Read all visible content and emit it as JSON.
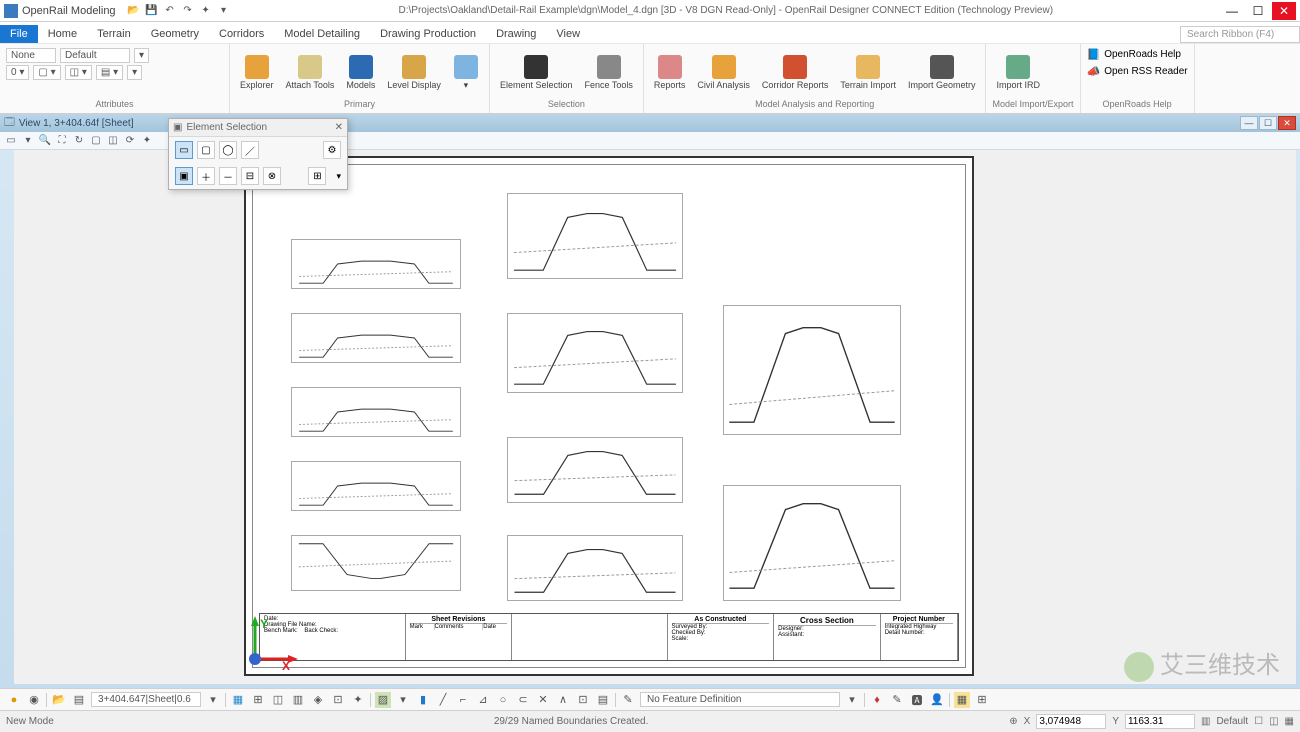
{
  "titlebar": {
    "app_name": "OpenRail Modeling",
    "document_title": "D:\\Projects\\Oakland\\Detail-Rail Example\\dgn\\Model_4.dgn [3D - V8 DGN Read-Only] - OpenRail Designer CONNECT Edition (Technology Preview)"
  },
  "ribbon": {
    "tabs": [
      "File",
      "Home",
      "Terrain",
      "Geometry",
      "Corridors",
      "Model Detailing",
      "Drawing Production",
      "Drawing",
      "View"
    ],
    "active_tab": "File",
    "search_placeholder": "Search Ribbon (F4)",
    "groups": {
      "attributes": {
        "label": "Attributes",
        "level": "None",
        "color": "Default"
      },
      "primary": {
        "label": "Primary",
        "buttons": [
          "Explorer",
          "Attach Tools",
          "Models",
          "Level Display"
        ]
      },
      "selection": {
        "label": "Selection",
        "buttons": [
          "Element Selection",
          "Fence Tools"
        ]
      },
      "model_analysis": {
        "label": "Model Analysis and Reporting",
        "buttons": [
          "Reports",
          "Civil Analysis",
          "Corridor Reports",
          "Terrain Import",
          "Import Geometry"
        ]
      },
      "model_import": {
        "label": "Model Import/Export",
        "buttons": [
          "Import IRD"
        ]
      },
      "openroads_help": {
        "label": "OpenRoads Help",
        "buttons": [
          "OpenRoads Help",
          "Open RSS Reader"
        ]
      }
    }
  },
  "view": {
    "title": "View 1, 3+404.64f [Sheet]"
  },
  "palette": {
    "title": "Element Selection"
  },
  "titleblock": {
    "sheet_revisions": "Sheet Revisions",
    "rev_cols": [
      "Mark",
      "Comments",
      "Date"
    ],
    "as_constructed": "As Constructed",
    "cross_section": "Cross Section",
    "project_number": "Project Number",
    "firm": "Integrated Highway",
    "rows": [
      "Date:",
      "Drawing File Name:",
      "Bench Mark:",
      "Back Check:"
    ],
    "rows2": [
      "Surveyed By:",
      "Checked By:",
      "Scale:"
    ],
    "rows3": [
      "Designer:",
      "Assistant:",
      "Detail Number:"
    ]
  },
  "bottom": {
    "snap_combo": "3+404.647|Sheet|0.6",
    "def_combo": "No Feature Definition"
  },
  "status": {
    "left": "New Mode",
    "message": "29/29 Named Boundaries Created.",
    "x_label": "X",
    "y_label": "Y",
    "x_val": "3,074948",
    "y_val": "1163.31",
    "level": "Default"
  },
  "watermark": "艾三维技术"
}
